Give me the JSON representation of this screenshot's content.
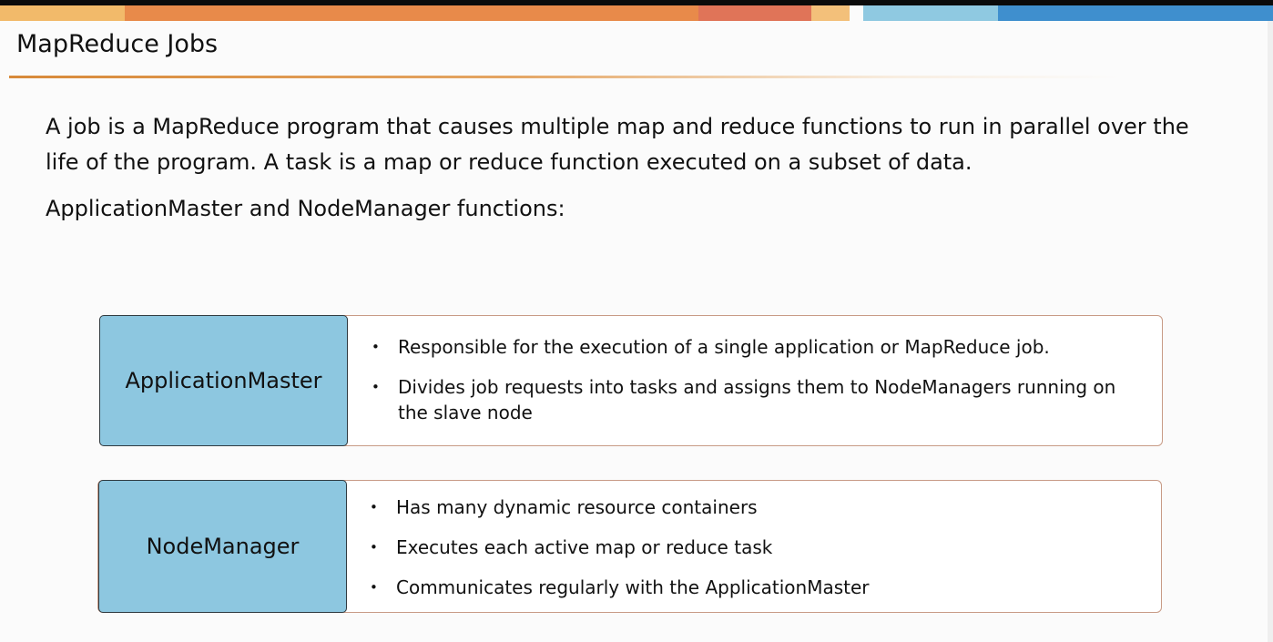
{
  "slide": {
    "title": "MapReduce Jobs",
    "intro_line_1": "A job is a MapReduce program that causes multiple map and reduce functions to run in parallel over the",
    "intro_line_2": "life of the program. A task is a map or reduce function executed on a subset of data.",
    "subheading": "ApplicationMaster and NodeManager functions:"
  },
  "header_colors": [
    "#f2ba6a",
    "#e88a4a",
    "#e07458",
    "#f3c07a",
    "#8fc9e1",
    "#3f8fce"
  ],
  "boxes": [
    {
      "label": "ApplicationMaster",
      "bullets": [
        "Responsible for the execution of a single application or MapReduce job.",
        "Divides job requests into tasks and assigns them to NodeManagers running on the slave node"
      ]
    },
    {
      "label": "NodeManager",
      "bullets": [
        "Has many dynamic resource containers",
        "Executes each active map or reduce task",
        "Communicates regularly with the ApplicationMaster"
      ]
    }
  ]
}
